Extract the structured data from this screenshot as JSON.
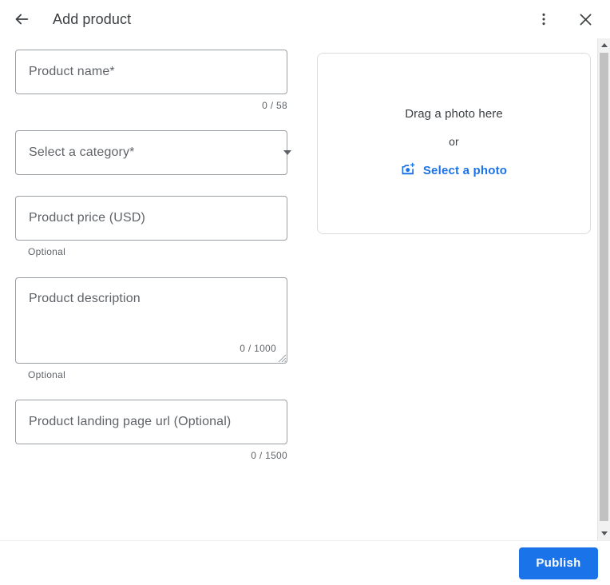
{
  "header": {
    "title": "Add product",
    "back_icon": "arrow-left-icon",
    "more_icon": "more-vert-icon",
    "close_icon": "close-icon"
  },
  "form": {
    "product_name": {
      "placeholder": "Product name*",
      "value": "",
      "counter": "0 / 58"
    },
    "category": {
      "placeholder": "Select a category*",
      "value": "",
      "arrow_icon": "chevron-down-icon"
    },
    "price": {
      "placeholder": "Product price (USD)",
      "value": "",
      "helper": "Optional"
    },
    "description": {
      "placeholder": "Product description",
      "value": "",
      "counter": "0 / 1000",
      "helper": "Optional"
    },
    "landing_page": {
      "placeholder": "Product landing page url (Optional)",
      "value": "",
      "counter": "0 / 1500"
    }
  },
  "photo": {
    "drag_text": "Drag a photo here",
    "or_text": "or",
    "select_label": "Select a photo",
    "select_icon": "camera-add-icon"
  },
  "footer": {
    "publish_label": "Publish"
  },
  "scrollbar": {
    "up_icon": "scroll-up-arrow-icon",
    "down_icon": "scroll-down-arrow-icon"
  },
  "colors": {
    "accent": "#1a73e8",
    "text_primary": "#3c4043",
    "text_secondary": "#5f6368",
    "border": "#9aa0a6",
    "border_light": "#dadce0"
  }
}
